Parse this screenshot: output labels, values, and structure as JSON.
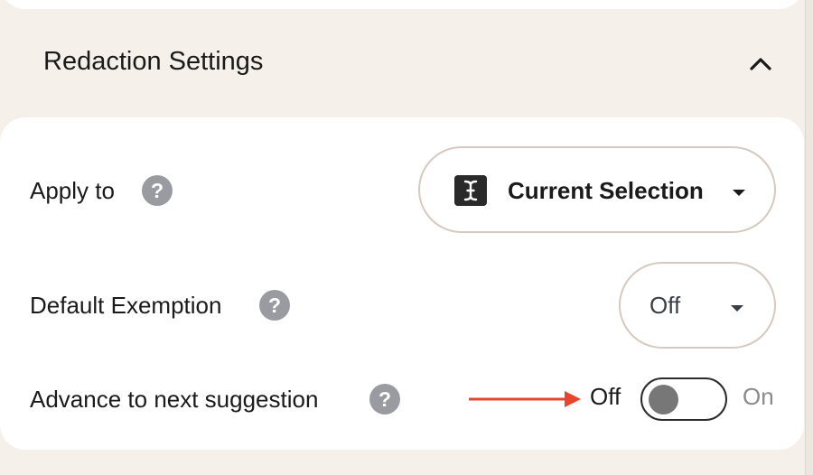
{
  "section": {
    "title": "Redaction Settings",
    "collapse_icon": "chevron-up-icon"
  },
  "rows": {
    "apply_to": {
      "label": "Apply to",
      "help_glyph": "?",
      "value": "Current Selection",
      "value_icon": "text-cursor-icon"
    },
    "default_exemption": {
      "label": "Default Exemption",
      "help_glyph": "?",
      "value": "Off"
    },
    "advance": {
      "label": "Advance to next suggestion",
      "help_glyph": "?",
      "off_label": "Off",
      "on_label": "On",
      "state": "off"
    }
  },
  "colors": {
    "page_background": "#f5f1ea",
    "card_background": "#ffffff",
    "pill_border": "#d6c9bf",
    "help_icon": "#9a9aa1",
    "annotation_arrow": "#e8452c",
    "toggle_knob": "#777777",
    "inactive_text": "#8a8a8a"
  }
}
